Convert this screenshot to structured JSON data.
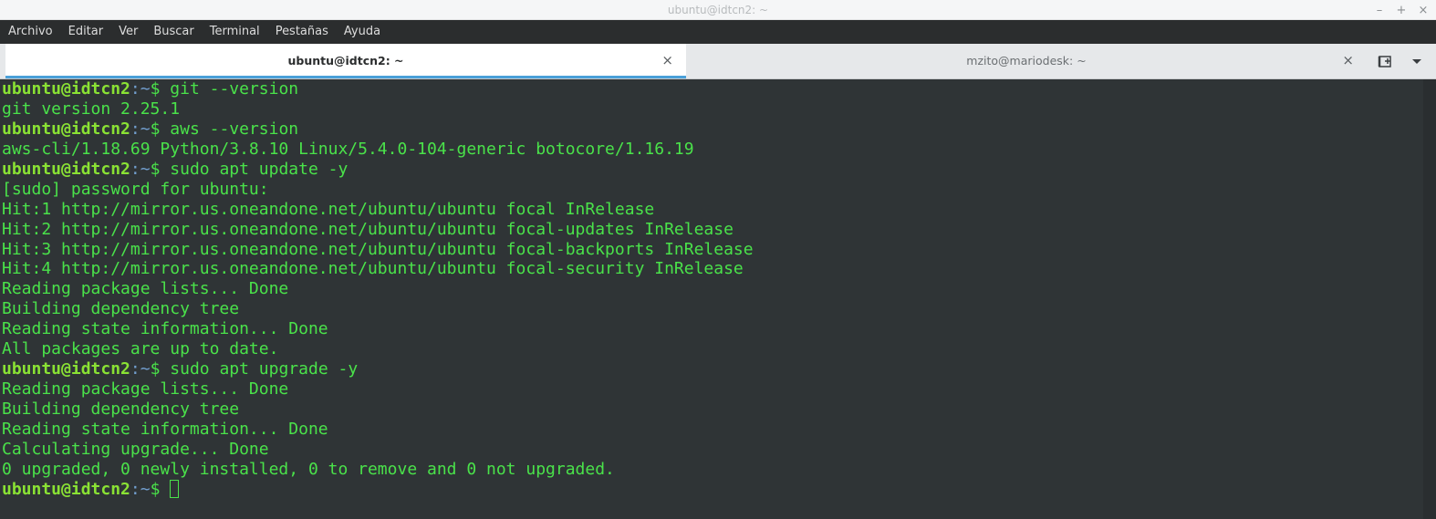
{
  "window": {
    "title": "ubuntu@idtcn2: ~",
    "controls": {
      "minimize": "–",
      "maximize": "+",
      "close": "×"
    }
  },
  "menubar": {
    "items": [
      "Archivo",
      "Editar",
      "Ver",
      "Buscar",
      "Terminal",
      "Pestañas",
      "Ayuda"
    ]
  },
  "tabs": [
    {
      "label": "ubuntu@idtcn2: ~",
      "active": true,
      "close": "×"
    },
    {
      "label": "mzito@mariodesk: ~",
      "active": false,
      "close": "×"
    }
  ],
  "tab_tools": {
    "new_tab_icon": "new-tab-icon",
    "dropdown_icon": "chevron-down-icon"
  },
  "colors": {
    "prompt_user": "#8ae234",
    "prompt_path": "#729fcf",
    "output": "#4ae24a",
    "terminal_bg": "#2f3436",
    "accent": "#4aa0d8"
  },
  "terminal": {
    "prompt": {
      "user": "ubuntu@idtcn2",
      "path": ":~",
      "symbol": "$ "
    },
    "lines": [
      {
        "type": "cmd",
        "text": "git --version"
      },
      {
        "type": "out",
        "text": "git version 2.25.1"
      },
      {
        "type": "cmd",
        "text": "aws --version"
      },
      {
        "type": "out",
        "text": "aws-cli/1.18.69 Python/3.8.10 Linux/5.4.0-104-generic botocore/1.16.19"
      },
      {
        "type": "cmd",
        "text": "sudo apt update -y"
      },
      {
        "type": "out",
        "text": "[sudo] password for ubuntu:"
      },
      {
        "type": "out",
        "text": "Hit:1 http://mirror.us.oneandone.net/ubuntu/ubuntu focal InRelease"
      },
      {
        "type": "out",
        "text": "Hit:2 http://mirror.us.oneandone.net/ubuntu/ubuntu focal-updates InRelease"
      },
      {
        "type": "out",
        "text": "Hit:3 http://mirror.us.oneandone.net/ubuntu/ubuntu focal-backports InRelease"
      },
      {
        "type": "out",
        "text": "Hit:4 http://mirror.us.oneandone.net/ubuntu/ubuntu focal-security InRelease"
      },
      {
        "type": "out",
        "text": "Reading package lists... Done"
      },
      {
        "type": "out",
        "text": "Building dependency tree"
      },
      {
        "type": "out",
        "text": "Reading state information... Done"
      },
      {
        "type": "out",
        "text": "All packages are up to date."
      },
      {
        "type": "cmd",
        "text": "sudo apt upgrade -y"
      },
      {
        "type": "out",
        "text": "Reading package lists... Done"
      },
      {
        "type": "out",
        "text": "Building dependency tree"
      },
      {
        "type": "out",
        "text": "Reading state information... Done"
      },
      {
        "type": "out",
        "text": "Calculating upgrade... Done"
      },
      {
        "type": "out",
        "text": "0 upgraded, 0 newly installed, 0 to remove and 0 not upgraded."
      },
      {
        "type": "cmd",
        "text": "",
        "cursor": true
      }
    ]
  }
}
